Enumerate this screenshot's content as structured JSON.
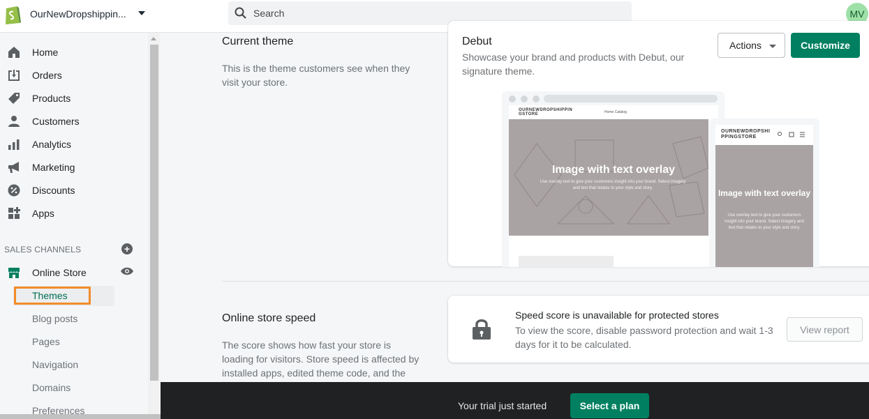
{
  "topbar": {
    "store_name": "OurNewDropshippin...",
    "search_placeholder": "Search",
    "avatar_initials": "MV"
  },
  "sidebar": {
    "items": [
      {
        "label": "Home",
        "icon": "home-icon"
      },
      {
        "label": "Orders",
        "icon": "orders-icon"
      },
      {
        "label": "Products",
        "icon": "tag-icon"
      },
      {
        "label": "Customers",
        "icon": "person-icon"
      },
      {
        "label": "Analytics",
        "icon": "bar-chart-icon"
      },
      {
        "label": "Marketing",
        "icon": "megaphone-icon"
      },
      {
        "label": "Discounts",
        "icon": "discount-icon"
      },
      {
        "label": "Apps",
        "icon": "apps-icon"
      }
    ],
    "sales_channels_header": "SALES CHANNELS",
    "online_store": "Online Store",
    "sub_items": [
      "Themes",
      "Blog posts",
      "Pages",
      "Navigation",
      "Domains",
      "Preferences"
    ],
    "active_sub_item": "Themes"
  },
  "current_theme": {
    "title": "Current theme",
    "description": "This is the theme customers see when they visit your store.",
    "theme_name": "Debut",
    "theme_description": "Showcase your brand and products with Debut, our signature theme.",
    "actions_label": "Actions",
    "customize_label": "Customize"
  },
  "preview": {
    "store_name_desktop": "OURNEWDROPSHIPPIN GSTORE",
    "nav_links": "Home   Catalog",
    "store_name_mobile": "OURNEWDROPSHI PPINGSTORE",
    "hero_title": "Image with text overlay",
    "hero_sub": "Use overlay text to give your customers insight into your brand. Select imagery and text that relates to your style and story."
  },
  "speed": {
    "title": "Online store speed",
    "description": "The score shows how fast your store is loading for visitors. Store speed is affected by installed apps, edited theme code, and the",
    "card_title": "Speed score is unavailable for protected stores",
    "card_desc": "To view the score, disable password protection and wait 1-3 days for it to be calculated.",
    "view_report_label": "View report"
  },
  "trial": {
    "text": "Your trial just started",
    "select_plan_label": "Select a plan"
  },
  "colors": {
    "primary": "#008060",
    "highlight": "#f28c28",
    "avatar_bg": "#9ee0a8",
    "trial_bar": "#202123"
  }
}
